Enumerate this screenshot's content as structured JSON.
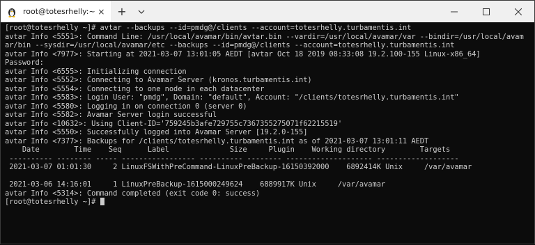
{
  "window": {
    "tab_title": "root@totesrhelly:~",
    "tab_close": "×",
    "new_tab": "+",
    "dropdown": "⌄"
  },
  "terminal": {
    "lines": [
      "[root@totesrhelly ~]# avtar --backups --id=pmdg@/clients --account=totesrhelly.turbamentis.int",
      "avtar Info <5551>: Command Line: /usr/local/avamar/bin/avtar.bin --vardir=/usr/local/avamar/var --bindir=/usr/local/avam",
      "ar/bin --sysdir=/usr/local/avamar/etc --backups --id=pmdg@/clients --account=totesrhelly.turbamentis.int",
      "avtar Info <7977>: Starting at 2021-03-07 13:01:05 AEDT [avtar Oct 18 2019 08:33:08 19.2.100-155 Linux-x86_64]",
      "Password:",
      "avtar Info <6555>: Initializing connection",
      "avtar Info <5552>: Connecting to Avamar Server (kronos.turbamentis.int)",
      "avtar Info <5554>: Connecting to one node in each datacenter",
      "avtar Info <5583>: Login User: \"pmdg\", Domain: \"default\", Account: \"/clients/totesrhelly.turbamentis.int\"",
      "avtar Info <5580>: Logging in on connection 0 (server 0)",
      "avtar Info <5582>: Avamar Server login successful",
      "avtar Info <10632>: Using Client-ID='759245b3afe729755c7367355275071f62215519'",
      "avtar Info <5550>: Successfully logged into Avamar Server [19.2.0-155]",
      "avtar Info <7377>: Backups for /clients/totesrhelly.turbamentis.int as of 2021-03-07 13:01:11 AEDT",
      "    Date        Time    Seq      Label              Size     Plugin    Working directory        Targets",
      " ---------- -------- ----- ----------------- ---------- -------- -------------------- -------------------",
      " 2021-03-07 01:01:30     2 LinuxFSWithPreCommand-LinuxPreBackup-16150392000    6892414K Unix     /var/avamar",
      "",
      " 2021-03-06 14:16:01     1 LinuxPreBackup-1615000249624    6889917K Unix     /var/avamar",
      "avtar Info <5314>: Command completed (exit code 0: success)",
      "[root@totesrhelly ~]# "
    ]
  }
}
